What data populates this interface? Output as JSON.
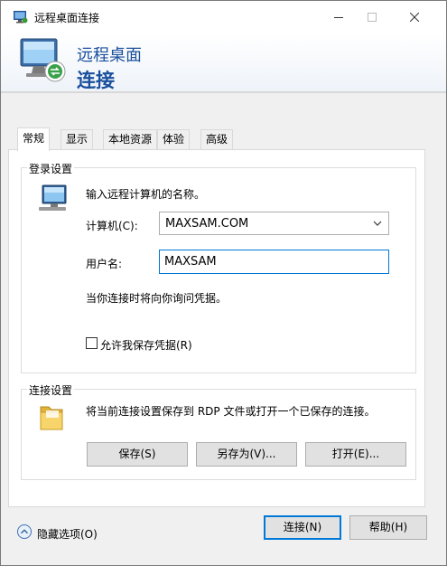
{
  "window": {
    "title": "远程桌面连接",
    "minimize_icon": "minimize-icon",
    "maximize_icon": "maximize-icon",
    "close_icon": "close-icon"
  },
  "banner": {
    "line1": "远程桌面",
    "line2": "连接",
    "icon": "remote-desktop-monitor-icon",
    "accent": "#1a4f9c"
  },
  "tabs": [
    {
      "label": "常规",
      "active": true
    },
    {
      "label": "显示",
      "active": false
    },
    {
      "label": "本地资源",
      "active": false
    },
    {
      "label": "体验",
      "active": false
    },
    {
      "label": "高级",
      "active": false
    }
  ],
  "login": {
    "group_title": "登录设置",
    "instruction": "输入远程计算机的名称。",
    "computer_label": "计算机(C):",
    "computer_value": "MAXSAM.COM",
    "username_label": "用户名:",
    "username_value": "MAXSAM",
    "credential_note": "当你连接时将向你询问凭据。",
    "save_credentials_label": "允许我保存凭据(R)",
    "save_credentials_checked": false
  },
  "connection": {
    "group_title": "连接设置",
    "description": "将当前连接设置保存到 RDP 文件或打开一个已保存的连接。",
    "save_button": "保存(S)",
    "save_as_button": "另存为(V)...",
    "open_button": "打开(E)..."
  },
  "footer": {
    "hide_options": "隐藏选项(O)",
    "connect_button": "连接(N)",
    "help_button": "帮助(H)"
  }
}
